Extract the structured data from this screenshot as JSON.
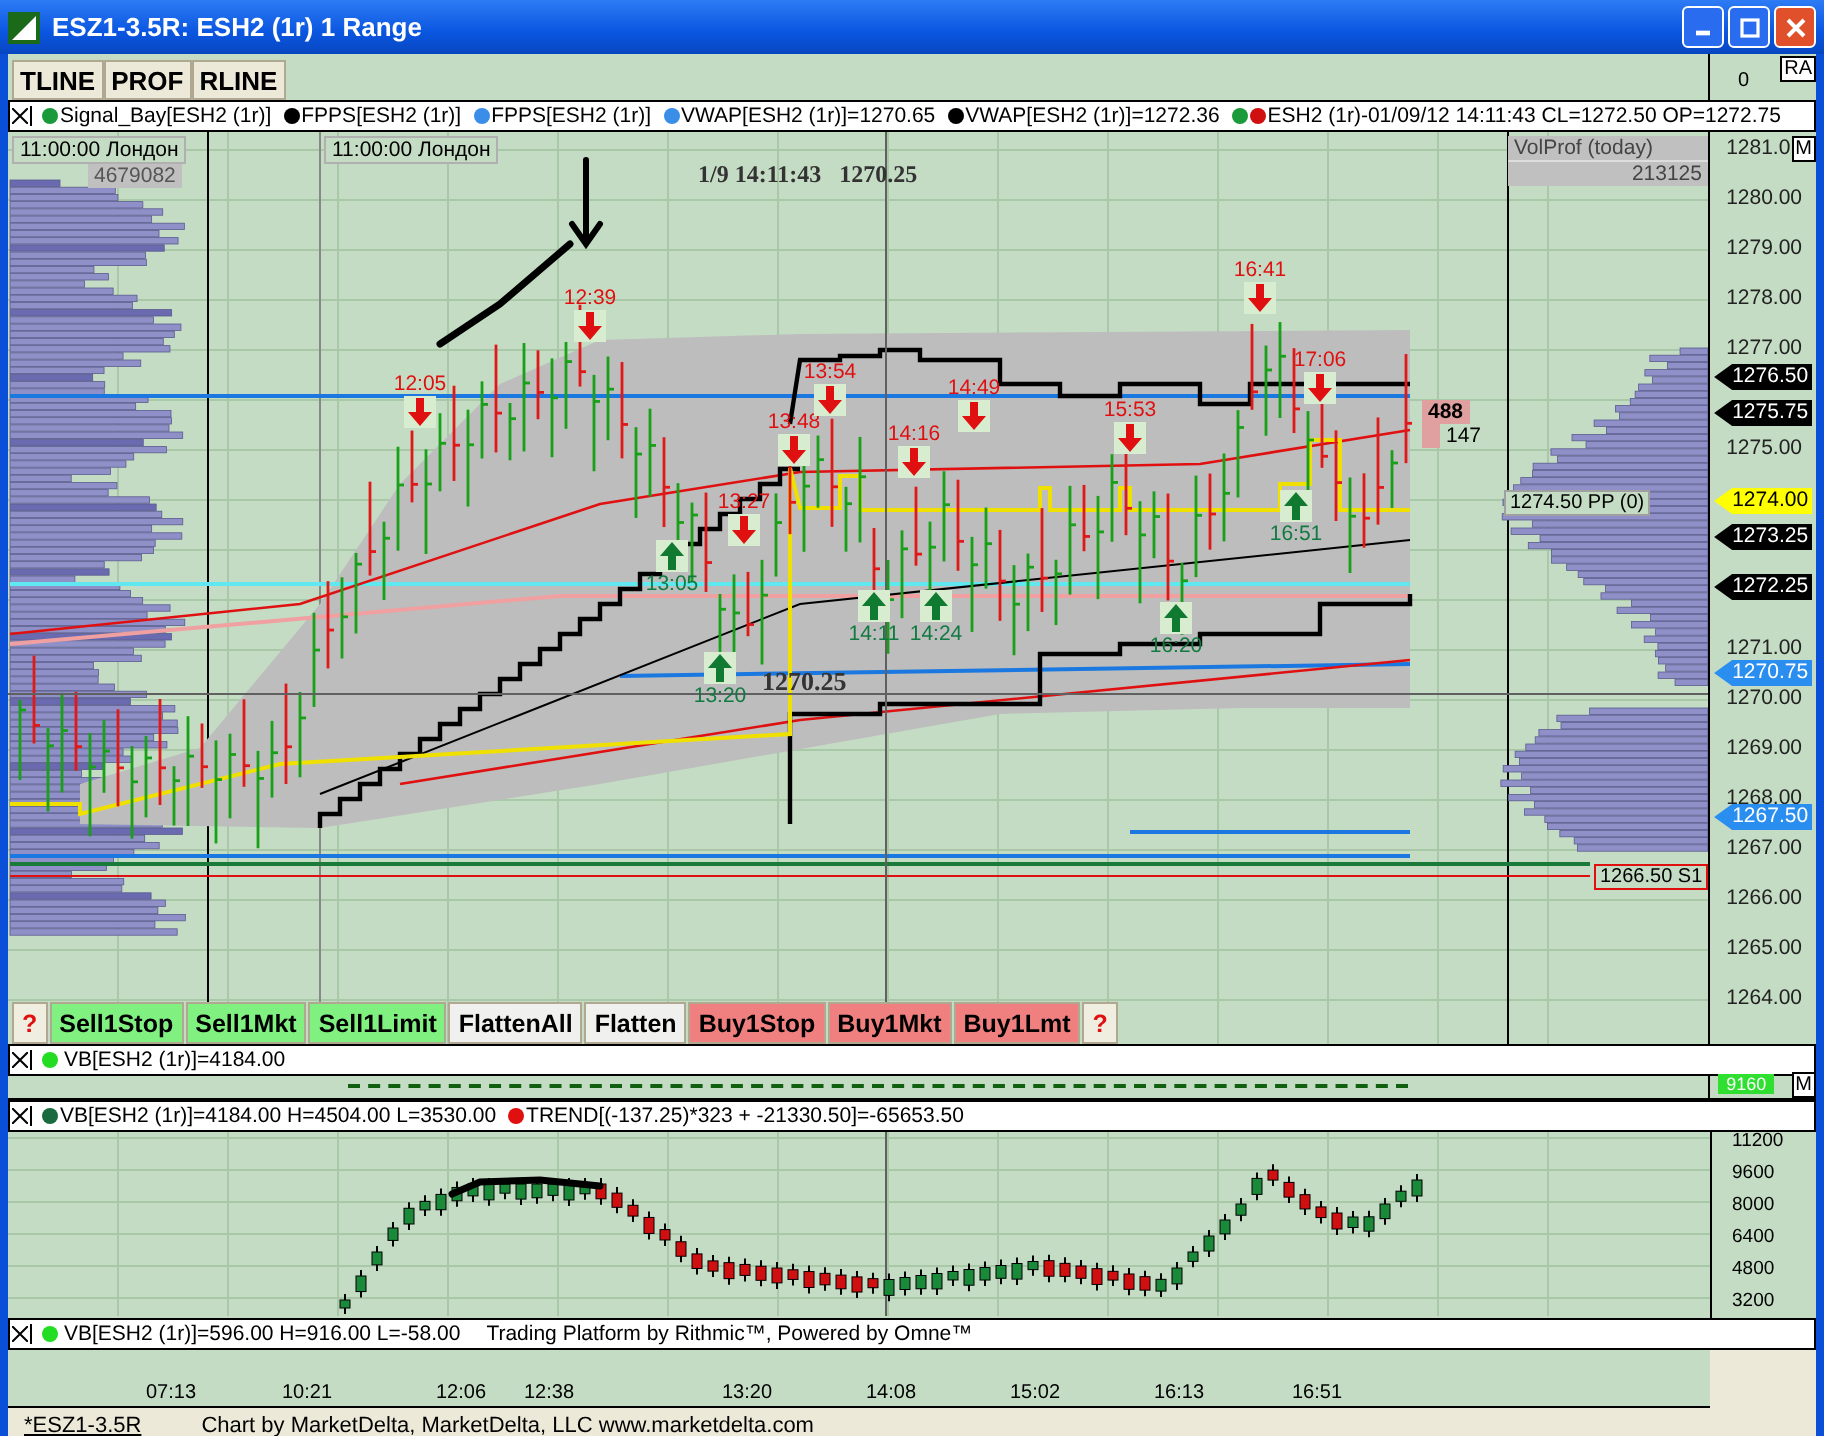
{
  "window": {
    "title": "ESZ1-3.5R: ESH2 (1r) 1 Range"
  },
  "toolbar": [
    "TLINE",
    "PROF",
    "RLINE"
  ],
  "axis_corner": {
    "top_value": "0",
    "label": "RA"
  },
  "legend": [
    {
      "text": "Signal_Bay[ESH2 (1r)]",
      "dots": [
        {
          "color": "#1a9a3a"
        }
      ]
    },
    {
      "text": "FPPS[ESH2 (1r)]",
      "dots": [
        {
          "color": "#000000"
        }
      ]
    },
    {
      "text": "FPPS[ESH2 (1r)]",
      "dots": [
        {
          "color": "#3a8ee8"
        }
      ]
    },
    {
      "text": "VWAP[ESH2 (1r)]=1270.65",
      "dots": [
        {
          "color": "#3a8ee8"
        }
      ]
    },
    {
      "text": "VWAP[ESH2 (1r)]=1272.36",
      "dots": [
        {
          "color": "#000000"
        }
      ]
    },
    {
      "text": "ESH2 (1r)-01/09/12 14:11:43 CL=1272.50 OP=1272.75",
      "dots": [
        {
          "color": "#1a9a3a"
        },
        {
          "color": "#d01010"
        }
      ]
    }
  ],
  "session_labels": [
    "11:00:00 Лондон",
    "11:00:00 Лондон"
  ],
  "session_value": "4679082",
  "cursor": {
    "time": "1/9 14:11:43",
    "price": "1270.25"
  },
  "volprof": {
    "title": "VolProf (today)",
    "total": "213125"
  },
  "price_axis": {
    "corner": "M",
    "ticks": [
      "1281.0",
      "1280.00",
      "1279.00",
      "1278.00",
      "1277.00",
      "1275.00",
      "1271.00",
      "1270.00",
      "1269.00",
      "1268.00",
      "1267.00",
      "1266.00",
      "1265.00",
      "1264.00"
    ]
  },
  "price_tags": [
    {
      "text": "1276.50",
      "color": "#000000"
    },
    {
      "text": "1275.75",
      "color": "#000000"
    },
    {
      "text": "1274.00",
      "color": "#ffff00"
    },
    {
      "text": "1273.25",
      "color": "#000000"
    },
    {
      "text": "1272.25",
      "color": "#000000"
    },
    {
      "text": "1270.75",
      "color": "#2a8ef0"
    },
    {
      "text": "1267.50",
      "color": "#2a8ef0"
    }
  ],
  "levels": [
    {
      "text": "1274.50 PP (0)",
      "color": "#a0a0a0"
    },
    {
      "text": "1266.50 S1",
      "color": "#e01010"
    }
  ],
  "signals": [
    {
      "time": "12:05",
      "kind": "sell"
    },
    {
      "time": "12:39",
      "kind": "sell"
    },
    {
      "time": "13:05",
      "kind": "buy"
    },
    {
      "time": "13:20",
      "kind": "buy"
    },
    {
      "time": "13:27",
      "kind": "sell"
    },
    {
      "time": "13:48",
      "kind": "sell"
    },
    {
      "time": "13:54",
      "kind": "sell"
    },
    {
      "time": "14:11",
      "kind": "buy"
    },
    {
      "time": "14:16",
      "kind": "sell"
    },
    {
      "time": "14:24",
      "kind": "buy"
    },
    {
      "time": "14:49",
      "kind": "sell"
    },
    {
      "time": "15:53",
      "kind": "sell"
    },
    {
      "time": "16:20",
      "kind": "buy"
    },
    {
      "time": "16:41",
      "kind": "sell"
    },
    {
      "time": "16:51",
      "kind": "buy"
    },
    {
      "time": "17:06",
      "kind": "sell"
    }
  ],
  "bar_counts": [
    "488",
    "147"
  ],
  "chart_price_label": "1270.25",
  "trade_buttons": [
    {
      "label": "?",
      "kind": "help"
    },
    {
      "label": "Sell1Stop",
      "kind": "sell"
    },
    {
      "label": "Sell1Mkt",
      "kind": "sell"
    },
    {
      "label": "Sell1Limit",
      "kind": "sell"
    },
    {
      "label": "FlattenAll",
      "kind": "flatten"
    },
    {
      "label": "Flatten",
      "kind": "flatten"
    },
    {
      "label": "Buy1Stop",
      "kind": "buy"
    },
    {
      "label": "Buy1Mkt",
      "kind": "buy"
    },
    {
      "label": "Buy1Lmt",
      "kind": "buy"
    },
    {
      "label": "?",
      "kind": "help"
    }
  ],
  "vb_legend": {
    "text": "VB[ESH2 (1r)]=4184.00",
    "color": "#22dd22"
  },
  "vb_tag": "9160",
  "vb_corner": "M",
  "lower_legend": [
    {
      "text": "VB[ESH2 (1r)]=4184.00 H=4504.00 L=3530.00",
      "color": "#1a6a40"
    },
    {
      "text": "TREND[(-137.25)*323 + -21330.50]=-65653.50",
      "color": "#e01010"
    }
  ],
  "lower_axis": [
    "11200",
    "9600",
    "8000",
    "6400",
    "4800",
    "3200"
  ],
  "bottom_legend": {
    "text": "VB[ESH2 (1r)]=596.00 H=916.00 L=-58.00",
    "color": "#22dd22",
    "note": "Trading Platform by Rithmic™, Powered by Omne™"
  },
  "time_axis": [
    "07:13",
    "10:21",
    "12:06",
    "12:38",
    "13:20",
    "14:08",
    "15:02",
    "16:13",
    "16:51"
  ],
  "status_bar": {
    "link": "*ESZ1-3.5R",
    "text": "Chart by MarketDelta, MarketDelta, LLC www.marketdelta.com"
  }
}
